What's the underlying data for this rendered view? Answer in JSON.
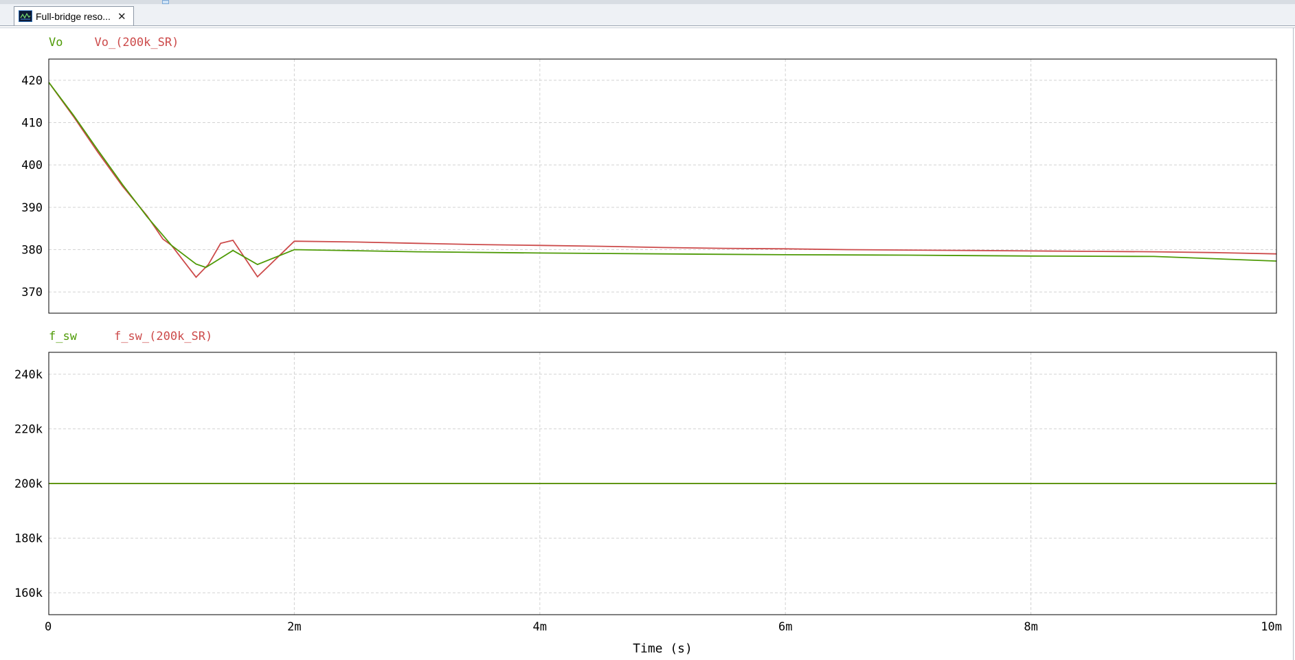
{
  "tab": {
    "label": "Full-bridge reso...",
    "close": "✕"
  },
  "colors": {
    "green": "#4e9a06",
    "red": "#cc4a4a",
    "grid": "#d2d2d2",
    "axis": "#000000"
  },
  "chart_data": [
    {
      "type": "line",
      "legend": [
        "Vo",
        "Vo_(200k_SR)"
      ],
      "xlim": [
        0,
        0.01
      ],
      "ylim": [
        365,
        425
      ],
      "yticks": [
        370,
        380,
        390,
        400,
        410,
        420
      ],
      "ytick_labels": [
        "370",
        "380",
        "390",
        "400",
        "410",
        "420"
      ],
      "grid": true,
      "series": [
        {
          "name": "Vo",
          "color": "green",
          "x": [
            0,
            0.0002,
            0.0004,
            0.0006,
            0.0008,
            0.001,
            0.0012,
            0.00128,
            0.0015,
            0.0017,
            0.002,
            0.003,
            0.004,
            0.005,
            0.006,
            0.007,
            0.008,
            0.009,
            0.01
          ],
          "y": [
            419.5,
            411.8,
            403.5,
            395.4,
            387.8,
            381.0,
            376.6,
            375.8,
            379.8,
            376.5,
            380.0,
            379.5,
            379.2,
            379.0,
            378.8,
            378.7,
            378.5,
            378.4,
            377.3
          ]
        },
        {
          "name": "Vo_(200k_SR)",
          "color": "red",
          "x": [
            0,
            0.0002,
            0.0004,
            0.0006,
            0.0008,
            0.00093,
            0.001,
            0.0012,
            0.0013,
            0.0014,
            0.0015,
            0.0017,
            0.002,
            0.0025,
            0.003,
            0.0035,
            0.004,
            0.0045,
            0.005,
            0.0055,
            0.006,
            0.0065,
            0.007,
            0.0075,
            0.008,
            0.0085,
            0.009,
            0.0095,
            0.01
          ],
          "y": [
            419.5,
            411.5,
            403.0,
            395.0,
            388.0,
            382.5,
            381.0,
            373.5,
            376.5,
            381.5,
            382.2,
            373.6,
            382.0,
            381.8,
            381.5,
            381.2,
            381.0,
            380.8,
            380.5,
            380.3,
            380.2,
            380.0,
            379.9,
            379.8,
            379.7,
            379.6,
            379.5,
            379.3,
            379.0
          ]
        }
      ]
    },
    {
      "type": "line",
      "legend": [
        "f_sw",
        "f_sw_(200k_SR)"
      ],
      "xlim": [
        0,
        0.01
      ],
      "ylim": [
        152000,
        248000
      ],
      "yticks": [
        160000,
        180000,
        200000,
        220000,
        240000
      ],
      "ytick_labels": [
        "160k",
        "180k",
        "200k",
        "220k",
        "240k"
      ],
      "grid": true,
      "series": [
        {
          "name": "f_sw",
          "color": "green",
          "x": [
            0,
            0.01
          ],
          "y": [
            200000,
            200000
          ]
        },
        {
          "name": "f_sw_(200k_SR)",
          "color": "red",
          "x": [
            0,
            0.01
          ],
          "y": [
            200000,
            200000
          ]
        }
      ]
    }
  ],
  "xaxis": {
    "ticks": [
      0,
      0.002,
      0.004,
      0.006,
      0.008,
      0.01
    ],
    "tick_labels": [
      "0",
      "2m",
      "4m",
      "6m",
      "8m",
      "10m"
    ],
    "label": "Time (s)"
  }
}
